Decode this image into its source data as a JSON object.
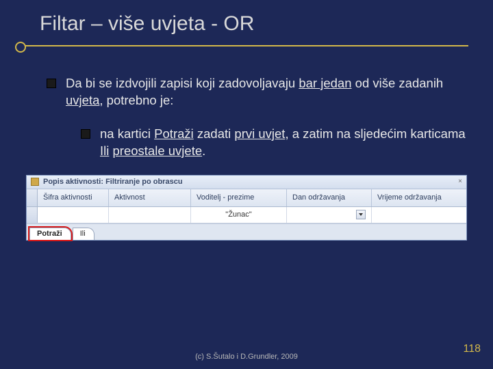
{
  "title": "Filtar – više uvjeta - OR",
  "bullet1": {
    "pre": "Da bi se izdvojili zapisi koji zadovoljavaju ",
    "u1": "bar jedan",
    "mid": " od više zadanih ",
    "u2": "uvjeta",
    "post": ", potrebno je:"
  },
  "bullet2": {
    "pre": "na kartici ",
    "u1": "Potraži",
    "mid1": " zadati ",
    "u2": "prvi uvjet",
    "mid2": ", a zatim na sljedećim karticama ",
    "u3": "Ili",
    "mid3": " ",
    "u4": "preostale uvjete",
    "post": "."
  },
  "screenshot": {
    "window_title": "Popis aktivnosti: Filtriranje po obrascu",
    "columns": {
      "c1": "Šifra aktivnosti",
      "c2": "Aktivnost",
      "c3": "Voditelj - prezime",
      "c4": "Dan održavanja",
      "c5": "Vrijeme održavanja"
    },
    "value_c3": "\"Žunac\"",
    "tabs": {
      "t1": "Potraži",
      "t2": "Ili"
    },
    "close": "×"
  },
  "footer": "(c) S.Šutalo i D.Grundler, 2009",
  "page": "118"
}
